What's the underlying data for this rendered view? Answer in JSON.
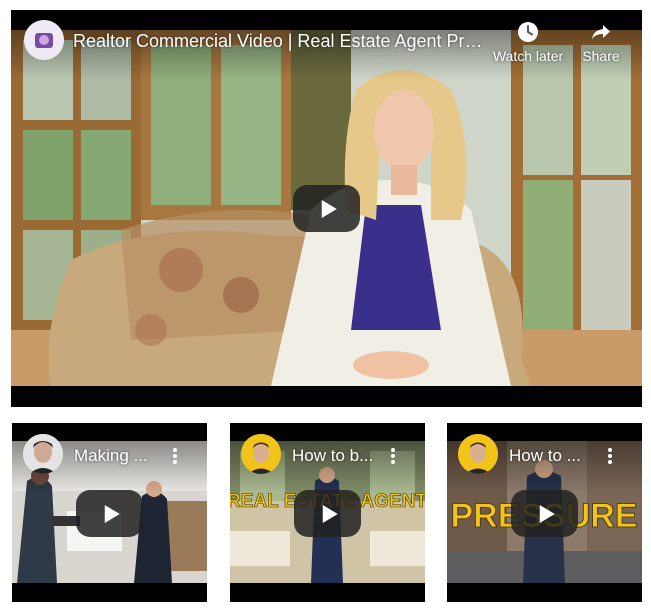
{
  "main_video": {
    "title": "Realtor Commercial Video | Real Estate Agent Pro...",
    "watch_later_label": "Watch later",
    "share_label": "Share"
  },
  "related_videos": [
    {
      "title": "Making ...",
      "overlay_text": ""
    },
    {
      "title": "How to b...",
      "overlay_text": "REAL ESTATE AGENT"
    },
    {
      "title": "How to ...",
      "overlay_text": "PRESSURE"
    }
  ],
  "colors": {
    "overlay_yellow": "#f2c318",
    "play_button": "#212121"
  },
  "icons": [
    "play-icon",
    "clock-icon",
    "share-arrow-icon",
    "more-vert-icon"
  ]
}
